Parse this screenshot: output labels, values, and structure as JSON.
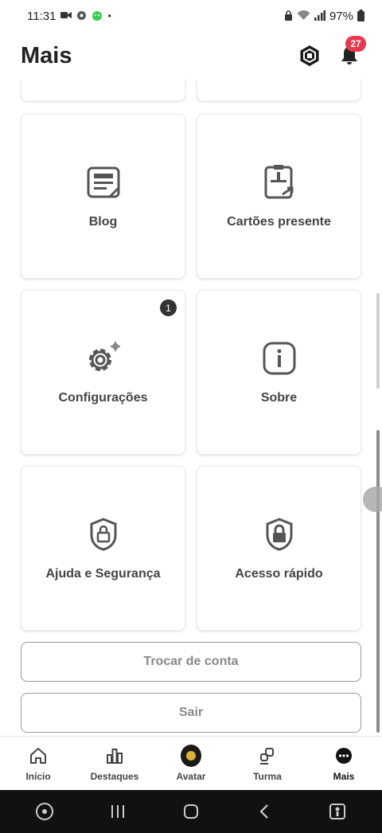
{
  "status_bar": {
    "time": "11:31",
    "battery": "97%"
  },
  "header": {
    "title": "Mais",
    "notification_count": "27"
  },
  "tiles": [
    {
      "label": "Blog",
      "icon": "blog-icon"
    },
    {
      "label": "Cartões presente",
      "icon": "gift-card-icon"
    },
    {
      "label": "Configurações",
      "icon": "gear-icon",
      "badge": "1"
    },
    {
      "label": "Sobre",
      "icon": "info-icon"
    },
    {
      "label": "Ajuda e Segurança",
      "icon": "shield-lock-icon"
    },
    {
      "label": "Acesso rápido",
      "icon": "lock-shield-icon"
    }
  ],
  "buttons": {
    "switch_account": "Trocar de conta",
    "logout": "Sair"
  },
  "bottom_nav": [
    {
      "label": "Início",
      "icon": "home-icon"
    },
    {
      "label": "Destaques",
      "icon": "chart-icon"
    },
    {
      "label": "Avatar",
      "icon": "avatar-icon"
    },
    {
      "label": "Turma",
      "icon": "people-icon"
    },
    {
      "label": "Mais",
      "icon": "more-icon",
      "active": true
    }
  ],
  "colors": {
    "badge_red": "#e8384f",
    "text_dark": "#222222",
    "button_text": "#888888"
  }
}
